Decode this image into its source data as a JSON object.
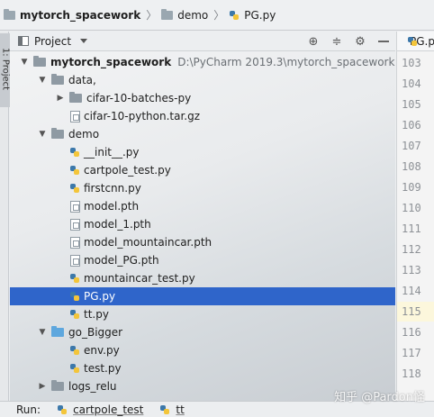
{
  "breadcrumb": [
    {
      "label": "mytorch_spacework",
      "icon": "folder-icon",
      "bold": true
    },
    {
      "label": "demo",
      "icon": "folder-icon",
      "bold": false
    },
    {
      "label": "PG.py",
      "icon": "python-file-icon",
      "bold": false
    }
  ],
  "toolstrip": {
    "label": "1: Project"
  },
  "panel": {
    "title": "Project"
  },
  "tree": [
    {
      "label": "mytorch_spacework",
      "path": "D:\\PyCharm 2019.3\\mytorch_spacework",
      "type": "folder",
      "arrow": "expanded",
      "depth": 0,
      "bold": true
    },
    {
      "label": "data,",
      "type": "folder",
      "arrow": "expanded",
      "depth": 1
    },
    {
      "label": "cifar-10-batches-py",
      "type": "folder",
      "arrow": "collapsed",
      "depth": 2
    },
    {
      "label": "cifar-10-python.tar.gz",
      "type": "file",
      "arrow": "none",
      "depth": 2
    },
    {
      "label": "demo",
      "type": "folder",
      "arrow": "expanded",
      "depth": 1
    },
    {
      "label": "__init__.py",
      "type": "python",
      "arrow": "none",
      "depth": 2
    },
    {
      "label": "cartpole_test.py",
      "type": "python",
      "arrow": "none",
      "depth": 2
    },
    {
      "label": "firstcnn.py",
      "type": "python",
      "arrow": "none",
      "depth": 2
    },
    {
      "label": "model.pth",
      "type": "file",
      "arrow": "none",
      "depth": 2
    },
    {
      "label": "model_1.pth",
      "type": "file",
      "arrow": "none",
      "depth": 2
    },
    {
      "label": "model_mountaincar.pth",
      "type": "file",
      "arrow": "none",
      "depth": 2
    },
    {
      "label": "model_PG.pth",
      "type": "file",
      "arrow": "none",
      "depth": 2
    },
    {
      "label": "mountaincar_test.py",
      "type": "python",
      "arrow": "none",
      "depth": 2
    },
    {
      "label": "PG.py",
      "type": "python",
      "arrow": "none",
      "depth": 2,
      "selected": true
    },
    {
      "label": "tt.py",
      "type": "python",
      "arrow": "none",
      "depth": 2
    },
    {
      "label": "go_Bigger",
      "type": "folder-blue",
      "arrow": "expanded",
      "depth": 1
    },
    {
      "label": "env.py",
      "type": "python",
      "arrow": "none",
      "depth": 2
    },
    {
      "label": "test.py",
      "type": "python",
      "arrow": "none",
      "depth": 2
    },
    {
      "label": "logs_relu",
      "type": "folder",
      "arrow": "collapsed",
      "depth": 1
    }
  ],
  "editor": {
    "tab_label": "PG.py",
    "line_numbers": [
      "103",
      "104",
      "105",
      "106",
      "107",
      "108",
      "109",
      "110",
      "111",
      "112",
      "113",
      "114",
      "115",
      "116",
      "117",
      "118"
    ],
    "current_line": "115"
  },
  "runbar": {
    "label": "Run:",
    "tabs": [
      "cartpole_test",
      "tt"
    ]
  },
  "watermark": "知乎 @Pardon怪"
}
